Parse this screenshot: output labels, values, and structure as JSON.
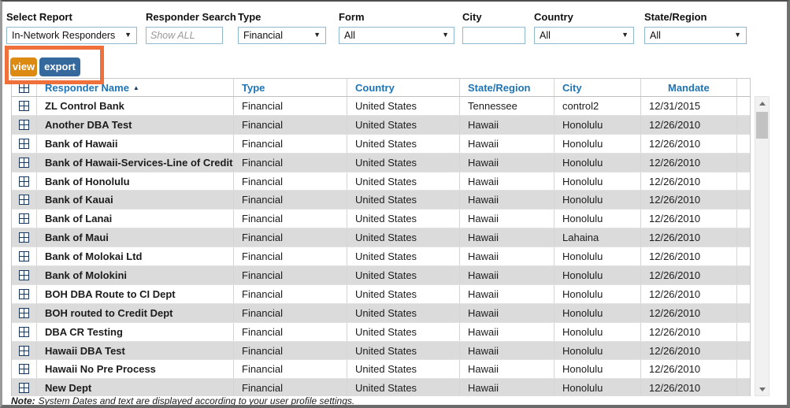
{
  "filters": [
    {
      "label": "Select Report",
      "type": "select",
      "value": "In-Network Responders"
    },
    {
      "label": "Responder Search",
      "type": "input",
      "value": "",
      "placeholder": "Show ALL"
    },
    {
      "label": "Type",
      "type": "select",
      "value": "Financial"
    },
    {
      "label": "Form",
      "type": "select",
      "value": "All"
    },
    {
      "label": "City",
      "type": "input",
      "value": "",
      "placeholder": ""
    },
    {
      "label": "Country",
      "type": "select",
      "value": "All"
    },
    {
      "label": "State/Region",
      "type": "select",
      "value": "All"
    }
  ],
  "actions": {
    "view_label": "view",
    "export_label": "export"
  },
  "annotation": {
    "shape": "rectangle",
    "color": "#f0703c",
    "purpose": "highlights view and export buttons"
  },
  "table": {
    "columns": [
      "Responder Name",
      "Type",
      "Country",
      "State/Region",
      "City",
      "Mandate"
    ],
    "sort": {
      "column": "Responder Name",
      "direction": "ascending",
      "indicator": "▲"
    },
    "rows": [
      [
        "ZL Control Bank",
        "Financial",
        "United States",
        "Tennessee",
        "control2",
        "12/31/2015"
      ],
      [
        "Another DBA Test",
        "Financial",
        "United States",
        "Hawaii",
        "Honolulu",
        "12/26/2010"
      ],
      [
        "Bank of Hawaii",
        "Financial",
        "United States",
        "Hawaii",
        "Honolulu",
        "12/26/2010"
      ],
      [
        "Bank of Hawaii-Services-Line of Credit",
        "Financial",
        "United States",
        "Hawaii",
        "Honolulu",
        "12/26/2010"
      ],
      [
        "Bank of Honolulu",
        "Financial",
        "United States",
        "Hawaii",
        "Honolulu",
        "12/26/2010"
      ],
      [
        "Bank of Kauai",
        "Financial",
        "United States",
        "Hawaii",
        "Honolulu",
        "12/26/2010"
      ],
      [
        "Bank of Lanai",
        "Financial",
        "United States",
        "Hawaii",
        "Honolulu",
        "12/26/2010"
      ],
      [
        "Bank of Maui",
        "Financial",
        "United States",
        "Hawaii",
        "Lahaina",
        "12/26/2010"
      ],
      [
        "Bank of Molokai Ltd",
        "Financial",
        "United States",
        "Hawaii",
        "Honolulu",
        "12/26/2010"
      ],
      [
        "Bank of Molokini",
        "Financial",
        "United States",
        "Hawaii",
        "Honolulu",
        "12/26/2010"
      ],
      [
        "BOH DBA Route to CI Dept",
        "Financial",
        "United States",
        "Hawaii",
        "Honolulu",
        "12/26/2010"
      ],
      [
        "BOH routed to Credit Dept",
        "Financial",
        "United States",
        "Hawaii",
        "Honolulu",
        "12/26/2010"
      ],
      [
        "DBA CR Testing",
        "Financial",
        "United States",
        "Hawaii",
        "Honolulu",
        "12/26/2010"
      ],
      [
        "Hawaii DBA Test",
        "Financial",
        "United States",
        "Hawaii",
        "Honolulu",
        "12/26/2010"
      ],
      [
        "Hawaii No Pre Process",
        "Financial",
        "United States",
        "Hawaii",
        "Honolulu",
        "12/26/2010"
      ],
      [
        "New Dept",
        "Financial",
        "United States",
        "Hawaii",
        "Honolulu",
        "12/26/2010"
      ]
    ]
  },
  "note": {
    "prefix": "Note:",
    "text": "System Dates and text are displayed according to your user profile settings."
  },
  "icons": {
    "expand_row": "plus-in-box",
    "dropdown": "caret-down",
    "scroll_up": "triangle-up",
    "scroll_down": "triangle-down"
  },
  "colors": {
    "header_text": "#1f74b5",
    "view_button": "#dc8a12",
    "export_button": "#35699e",
    "annotation": "#f0703c",
    "alt_row": "#dbdbdb",
    "expand_icon": "#17365d",
    "control_border": "#8fb9d0"
  }
}
